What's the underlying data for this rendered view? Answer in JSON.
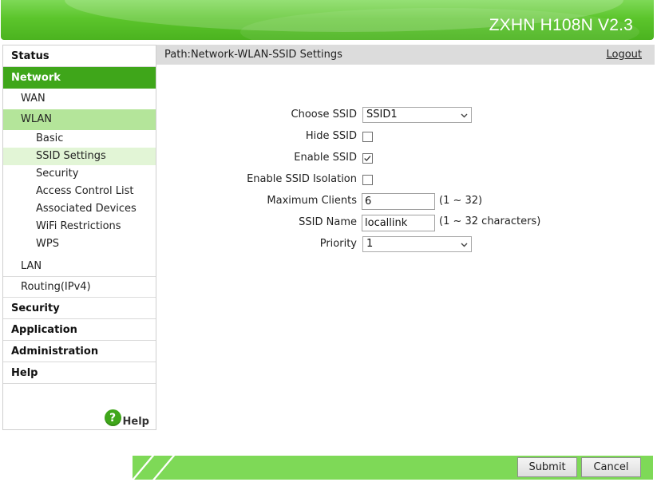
{
  "header": {
    "brand": "ZXHN H108N V2.3"
  },
  "sidebar": {
    "status": "Status",
    "network": "Network",
    "wan": "WAN",
    "wlan": "WLAN",
    "wlan_items": [
      "Basic",
      "SSID Settings",
      "Security",
      "Access Control List",
      "Associated Devices",
      "WiFi Restrictions",
      "WPS"
    ],
    "lan": "LAN",
    "routing": "Routing(IPv4)",
    "security": "Security",
    "application": "Application",
    "administration": "Administration",
    "help": "Help",
    "help_link": "Help",
    "help_icon_glyph": "?"
  },
  "pathbar": {
    "path": "Path:Network-WLAN-SSID Settings",
    "logout": "Logout"
  },
  "form": {
    "choose_ssid": {
      "label": "Choose SSID",
      "value": "SSID1"
    },
    "hide_ssid": {
      "label": "Hide SSID",
      "checked": false
    },
    "enable_ssid": {
      "label": "Enable SSID",
      "checked": true
    },
    "ssid_isolation": {
      "label": "Enable SSID Isolation",
      "checked": false
    },
    "max_clients": {
      "label": "Maximum Clients",
      "value": "6",
      "hint": "(1 ~ 32)"
    },
    "ssid_name": {
      "label": "SSID Name",
      "value": "locallink",
      "hint": "(1 ~ 32 characters)"
    },
    "priority": {
      "label": "Priority",
      "value": "1"
    }
  },
  "buttons": {
    "submit": "Submit",
    "cancel": "Cancel"
  },
  "colors": {
    "brand_green": "#3fa61a",
    "header_green": "#5cc52c",
    "footer_green": "#7ed957",
    "wlan_highlight": "#b4e59a"
  },
  "icons": {
    "select_arrow": "chevron-down-icon",
    "checked": "check-icon",
    "help": "help-circle-icon"
  }
}
